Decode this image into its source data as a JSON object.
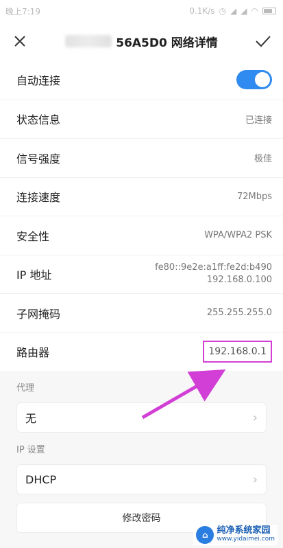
{
  "status_bar": {
    "time": "晚上7:19",
    "speed": "0.1K/s",
    "icons": [
      "clock-icon",
      "signal-icon",
      "signal-icon",
      "wifi-icon",
      "battery-icon"
    ]
  },
  "header": {
    "title": "56A5D0 网络详情",
    "close_icon": "close-icon",
    "confirm_icon": "check-icon"
  },
  "rows": [
    {
      "label": "自动连接",
      "toggle": true
    },
    {
      "label": "状态信息",
      "value": "已连接"
    },
    {
      "label": "信号强度",
      "value": "极佳"
    },
    {
      "label": "连接速度",
      "value": "72Mbps"
    },
    {
      "label": "安全性",
      "value": "WPA/WPA2 PSK"
    },
    {
      "label": "IP 地址",
      "value_lines": [
        "fe80::9e2e:a1ff:fe2d:b490",
        "192.168.0.100"
      ]
    },
    {
      "label": "子网掩码",
      "value": "255.255.255.0"
    },
    {
      "label": "路由器",
      "value": "192.168.0.1"
    }
  ],
  "proxy": {
    "label": "代理",
    "value": "无"
  },
  "ip_settings": {
    "label": "IP 设置",
    "value": "DHCP"
  },
  "modify_password": "修改密码",
  "watermark": {
    "title": "纯净系统家园",
    "url": "www.yidaimei.com"
  },
  "colors": {
    "toggle": "#2f8bf0",
    "highlight": "#d23fd6"
  }
}
